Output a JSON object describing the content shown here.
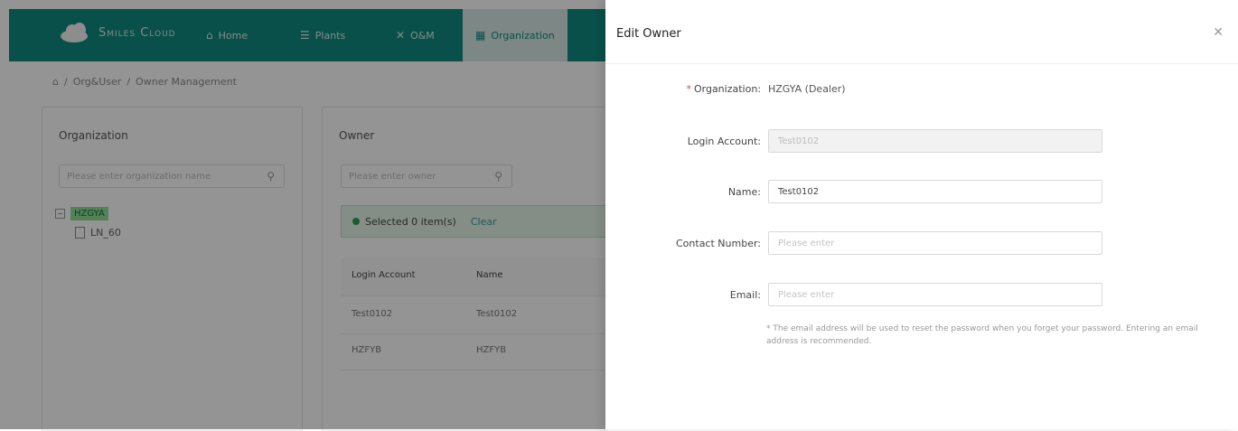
{
  "header": {
    "brand": "Smiles Cloud",
    "nav": [
      {
        "icon": "home-icon",
        "glyph": "⌂",
        "label": "Home"
      },
      {
        "icon": "plants-icon",
        "glyph": "☰",
        "label": "Plants"
      },
      {
        "icon": "om-icon",
        "glyph": "✕",
        "label": "O&M"
      },
      {
        "icon": "organization-icon",
        "glyph": "▦",
        "label": "Organization"
      }
    ]
  },
  "breadcrumb": {
    "first": "Org&User",
    "current": "Owner Management",
    "sep": "/"
  },
  "org_panel": {
    "title": "Organization",
    "search_placeholder": "Please enter organization name",
    "root": "HZGYA",
    "child": "LN_60"
  },
  "owner_panel": {
    "title": "Owner",
    "search_placeholder": "Please enter owner",
    "selected_text": "Selected 0 item(s)",
    "clear_label": "Clear",
    "columns": [
      "Login Account",
      "Name"
    ],
    "rows": [
      [
        "Test0102",
        "Test0102"
      ],
      [
        "HZFYB",
        "HZFYB"
      ]
    ]
  },
  "drawer": {
    "title": "Edit Owner",
    "close_glyph": "✕",
    "org_label": "Organization:",
    "org_value": "HZGYA   (Dealer)",
    "login_label": "Login Account:",
    "login_value": "Test0102",
    "name_label": "Name:",
    "name_value": "Test0102",
    "contact_label": "Contact Number:",
    "contact_placeholder": "Please enter",
    "email_label": "Email:",
    "email_placeholder": "Please enter",
    "hint": "* The email address will be used to reset the password when you forget your password. Entering an email address is recommended."
  }
}
